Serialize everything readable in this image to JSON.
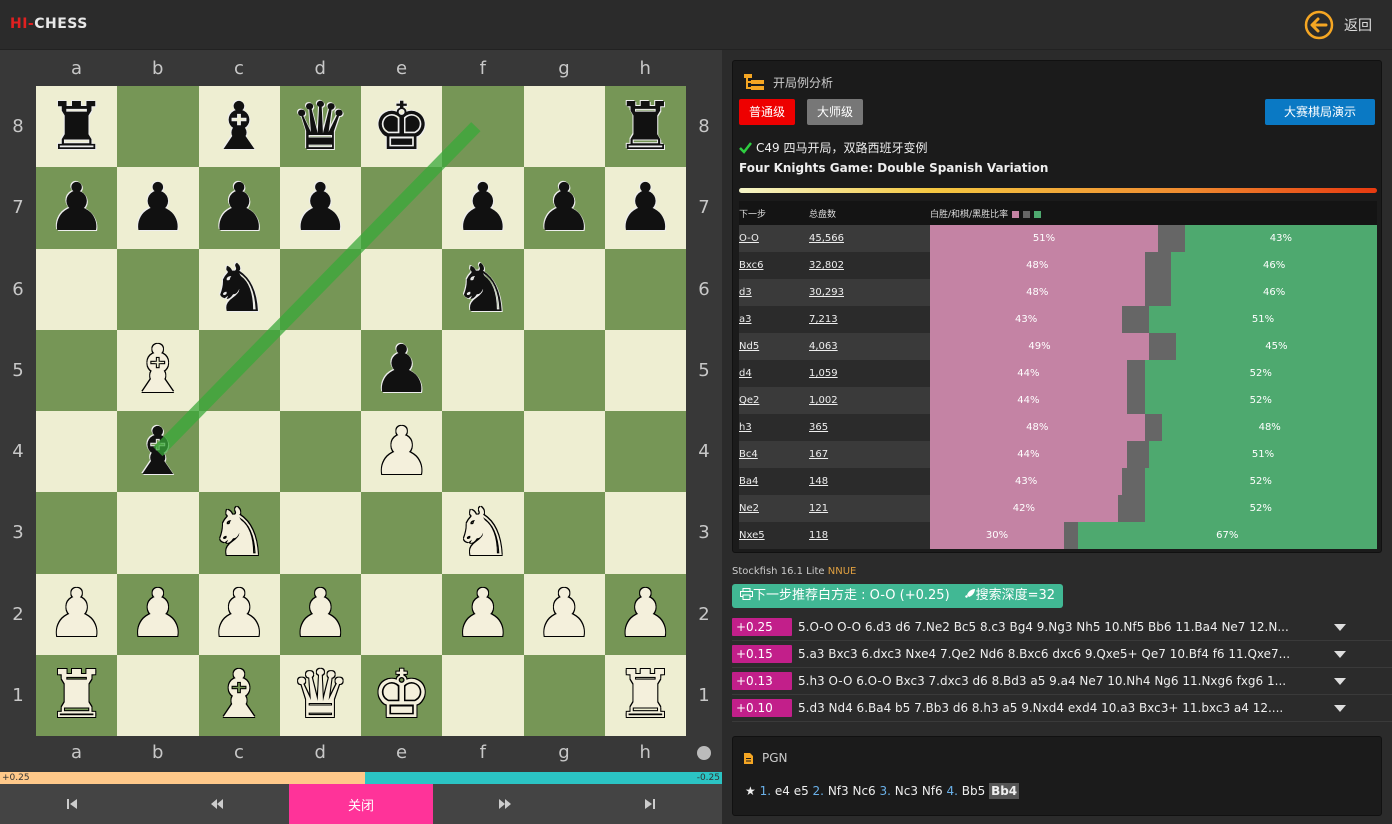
{
  "header": {
    "logo_hi": "HI-",
    "logo_rest": "CHESS",
    "back_label": "返回"
  },
  "board": {
    "files": [
      "a",
      "b",
      "c",
      "d",
      "e",
      "f",
      "g",
      "h"
    ],
    "ranks": [
      "8",
      "7",
      "6",
      "5",
      "4",
      "3",
      "2",
      "1"
    ],
    "pieces": [
      {
        "sq": "a8",
        "c": "b",
        "t": "r"
      },
      {
        "sq": "c8",
        "c": "b",
        "t": "b"
      },
      {
        "sq": "d8",
        "c": "b",
        "t": "q"
      },
      {
        "sq": "e8",
        "c": "b",
        "t": "k"
      },
      {
        "sq": "h8",
        "c": "b",
        "t": "r"
      },
      {
        "sq": "a7",
        "c": "b",
        "t": "p"
      },
      {
        "sq": "b7",
        "c": "b",
        "t": "p"
      },
      {
        "sq": "c7",
        "c": "b",
        "t": "p"
      },
      {
        "sq": "d7",
        "c": "b",
        "t": "p"
      },
      {
        "sq": "f7",
        "c": "b",
        "t": "p"
      },
      {
        "sq": "g7",
        "c": "b",
        "t": "p"
      },
      {
        "sq": "h7",
        "c": "b",
        "t": "p"
      },
      {
        "sq": "c6",
        "c": "b",
        "t": "n"
      },
      {
        "sq": "f6",
        "c": "b",
        "t": "n"
      },
      {
        "sq": "b5",
        "c": "w",
        "t": "b"
      },
      {
        "sq": "e5",
        "c": "b",
        "t": "p"
      },
      {
        "sq": "b4",
        "c": "b",
        "t": "b"
      },
      {
        "sq": "e4",
        "c": "w",
        "t": "p"
      },
      {
        "sq": "c3",
        "c": "w",
        "t": "n"
      },
      {
        "sq": "f3",
        "c": "w",
        "t": "n"
      },
      {
        "sq": "a2",
        "c": "w",
        "t": "p"
      },
      {
        "sq": "b2",
        "c": "w",
        "t": "p"
      },
      {
        "sq": "c2",
        "c": "w",
        "t": "p"
      },
      {
        "sq": "d2",
        "c": "w",
        "t": "p"
      },
      {
        "sq": "f2",
        "c": "w",
        "t": "p"
      },
      {
        "sq": "g2",
        "c": "w",
        "t": "p"
      },
      {
        "sq": "h2",
        "c": "w",
        "t": "p"
      },
      {
        "sq": "a1",
        "c": "w",
        "t": "r"
      },
      {
        "sq": "c1",
        "c": "w",
        "t": "b"
      },
      {
        "sq": "d1",
        "c": "w",
        "t": "q"
      },
      {
        "sq": "e1",
        "c": "w",
        "t": "k"
      },
      {
        "sq": "h1",
        "c": "w",
        "t": "r"
      }
    ],
    "arrow": {
      "from": "b4",
      "to": "f8",
      "color": "#3aa83a"
    },
    "light_color": "#eeeed2",
    "dark_color": "#769656"
  },
  "eval": {
    "white_label": "+0.25",
    "black_label": "-0.25",
    "white_fraction": 0.505
  },
  "controls": {
    "first": "first-icon",
    "prev": "prev-icon",
    "close_label": "关闭",
    "next": "next-icon",
    "last": "last-icon"
  },
  "opening": {
    "panel_title": "开局例分析",
    "btn_normal": "普通级",
    "btn_master": "大师级",
    "btn_demo": "大赛棋局演示",
    "name_cn": "C49 四马开局，双路西班牙变例",
    "name_en": "Four Knights Game: Double Spanish Variation",
    "col_move": "下一步",
    "col_total": "总盘数",
    "col_ratio": "白胜/和棋/黑胜比率",
    "swatch_colors": [
      "#c483a4",
      "#666666",
      "#4ea96f"
    ],
    "rows": [
      {
        "move": "O-O",
        "total": "45,566",
        "w": 51,
        "d": 6,
        "l": 43
      },
      {
        "move": "Bxc6",
        "total": "32,802",
        "w": 48,
        "d": 6,
        "l": 46
      },
      {
        "move": "d3",
        "total": "30,293",
        "w": 48,
        "d": 6,
        "l": 46
      },
      {
        "move": "a3",
        "total": "7,213",
        "w": 43,
        "d": 6,
        "l": 51
      },
      {
        "move": "Nd5",
        "total": "4,063",
        "w": 49,
        "d": 6,
        "l": 45
      },
      {
        "move": "d4",
        "total": "1,059",
        "w": 44,
        "d": 4,
        "l": 52
      },
      {
        "move": "Qe2",
        "total": "1,002",
        "w": 44,
        "d": 4,
        "l": 52
      },
      {
        "move": "h3",
        "total": "365",
        "w": 48,
        "d": 4,
        "l": 48
      },
      {
        "move": "Bc4",
        "total": "167",
        "w": 44,
        "d": 5,
        "l": 51
      },
      {
        "move": "Ba4",
        "total": "148",
        "w": 43,
        "d": 5,
        "l": 52
      },
      {
        "move": "Ne2",
        "total": "121",
        "w": 42,
        "d": 6,
        "l": 52
      },
      {
        "move": "Nxe5",
        "total": "118",
        "w": 30,
        "d": 3,
        "l": 67
      }
    ]
  },
  "engine": {
    "name": "Stockfish 16.1 Lite ",
    "nnue": "NNUE",
    "recommend": "下一步推荐白方走 : O-O (+0.25)",
    "depth": "搜索深度=32",
    "lines": [
      {
        "score": "+0.25",
        "pv": "5.O-O O-O 6.d3 d6 7.Ne2 Bc5 8.c3 Bg4 9.Ng3 Nh5 10.Nf5 Bb6 11.Ba4 Ne7 12.N..."
      },
      {
        "score": "+0.15",
        "pv": "5.a3 Bxc3 6.dxc3 Nxe4 7.Qe2 Nd6 8.Bxc6 dxc6 9.Qxe5+ Qe7 10.Bf4 f6 11.Qxe7..."
      },
      {
        "score": "+0.13",
        "pv": "5.h3 O-O 6.O-O Bxc3 7.dxc3 d6 8.Bd3 a5 9.a4 Ne7 10.Nh4 Ng6 11.Nxg6 fxg6 1..."
      },
      {
        "score": "+0.10",
        "pv": "5.d3 Nd4 6.Ba4 b5 7.Bb3 d6 8.h3 a5 9.Nxd4 exd4 10.a3 Bxc3+ 11.bxc3 a4 12...."
      }
    ]
  },
  "pgn": {
    "title": "PGN",
    "star": "★",
    "moves": [
      {
        "n": "1.",
        "w": "e4",
        "b": "e5"
      },
      {
        "n": "2.",
        "w": "Nf3",
        "b": "Nc6"
      },
      {
        "n": "3.",
        "w": "Nc3",
        "b": "Nf6"
      },
      {
        "n": "4.",
        "w": "Bb5",
        "b": "Bb4"
      }
    ]
  }
}
